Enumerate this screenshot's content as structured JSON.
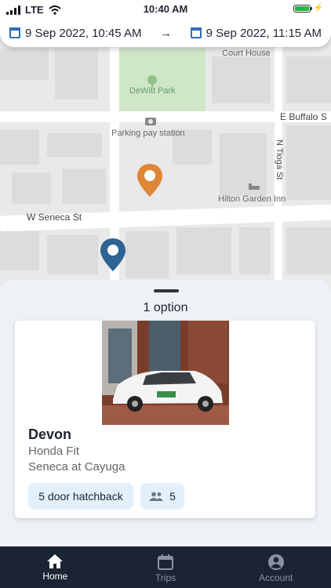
{
  "status_bar": {
    "carrier": "LTE",
    "time": "10:40 AM"
  },
  "booking": {
    "start": "9 Sep 2022, 10:45 AM",
    "arrow": "→",
    "end": "9 Sep 2022, 11:15 AM"
  },
  "map": {
    "labels": {
      "court_house": "Court House",
      "park": "DeWitt Park",
      "e_buffalo": "E Buffalo S",
      "parking": "Parking pay station",
      "n_tioga": "N Tioga St",
      "hilton": "Hilton Garden Inn",
      "w_seneca": "W Seneca St"
    },
    "colors": {
      "destination_pin": "#e08637",
      "origin_pin": "#2d6494"
    }
  },
  "results": {
    "count_label": "1 option",
    "vehicle": {
      "name": "Devon",
      "model": "Honda Fit",
      "location": "Seneca at Cayuga",
      "type_chip": "5 door hatchback",
      "seats": "5"
    }
  },
  "tabs": [
    {
      "label": "Home",
      "icon": "home-icon",
      "active": true
    },
    {
      "label": "Trips",
      "icon": "calendar-icon",
      "active": false
    },
    {
      "label": "Account",
      "icon": "account-icon",
      "active": false
    }
  ],
  "colors": {
    "accent": "#2d6fb7",
    "tabbar": "#1b2434",
    "chip": "#e1f0fb"
  }
}
